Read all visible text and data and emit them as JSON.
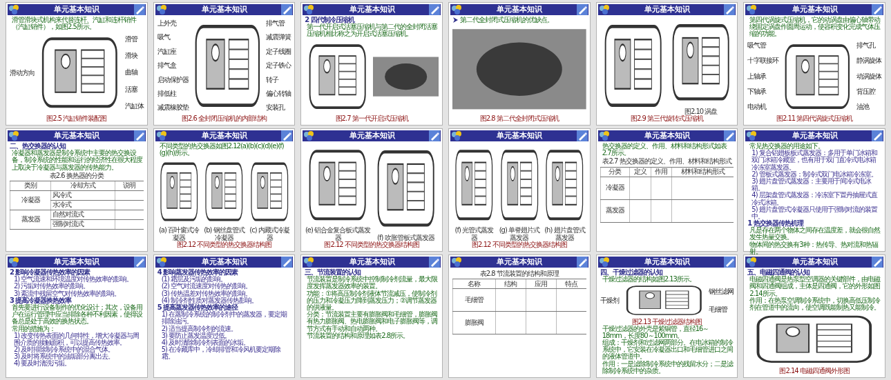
{
  "slides": [
    {
      "title": "单元基本知识",
      "blocks": [
        {
          "kind": "para",
          "text": "滑管滑块式机构来代替连杆、汽缸和连杆销件（汽缸销件），如图2.5所示。"
        },
        {
          "kind": "figures",
          "figures": [
            {
              "kind": "drawing",
              "labels_left": [
                "滑动方向"
              ],
              "labels_right": [
                "滑管",
                "滑块",
                "曲轴",
                "活塞",
                "汽缸体"
              ]
            }
          ]
        },
        {
          "kind": "caption",
          "text": "图2.5 汽缸销件装配图"
        }
      ]
    },
    {
      "title": "单元基本知识",
      "blocks": [
        {
          "kind": "figures",
          "figures": [
            {
              "kind": "drawing",
              "labels_left": [
                "上外壳",
                "吸气",
                "汽缸座",
                "排气盒",
                "启动保护器",
                "排低柱",
                "减震橡胶垫"
              ],
              "labels_right": [
                "排气管",
                "减震弹簧",
                "定子线圈",
                "定子铁心",
                "转子",
                "偏心转轴",
                "安装孔"
              ]
            }
          ]
        },
        {
          "kind": "caption",
          "text": "图2.6 全封闭压缩机的内部结构"
        }
      ]
    },
    {
      "title": "单元基本知识",
      "blocks": [
        {
          "kind": "heading",
          "text": "2 四代制冷压缩机"
        },
        {
          "kind": "para",
          "text": "第一代开启式活塞压缩机与第二代的全封闭活塞压缩机相比称之为开启式活塞压缩机。"
        },
        {
          "kind": "figures",
          "figures": [
            {
              "kind": "drawing"
            },
            {
              "kind": "photo"
            }
          ]
        },
        {
          "kind": "caption",
          "text": "图2.7 第一代开启式压缩机"
        }
      ]
    },
    {
      "title": "单元基本知识",
      "blocks": [
        {
          "kind": "bullet",
          "text": "第二代全封闭式压缩机的优缺点。"
        },
        {
          "kind": "figures",
          "figures": [
            {
              "kind": "photo"
            }
          ]
        },
        {
          "kind": "caption",
          "text": "图2.8 第二代全封闭式压缩机"
        }
      ]
    },
    {
      "title": "单元基本知识",
      "blocks": [
        {
          "kind": "figures",
          "figures": [
            {
              "kind": "drawing"
            },
            {
              "kind": "drawing",
              "caption": "图2.10 涡盘"
            }
          ]
        },
        {
          "kind": "caption",
          "text": "图2.9 第三代旋转式压缩机"
        }
      ]
    },
    {
      "title": "单元基本知识",
      "blocks": [
        {
          "kind": "para",
          "text": "第四代涡旋式压缩机，它的动涡盘由偏心轴带动绕固定涡盘作圆周运动，使容积变化完成气体压缩的功能。"
        },
        {
          "kind": "figures",
          "figures": [
            {
              "kind": "drawing",
              "labels_left": [
                "吸气管",
                "十字联接环",
                "上轴承",
                "下轴承",
                "电动机"
              ],
              "labels_right": [
                "排气孔",
                "静涡旋体",
                "动涡旋体",
                "背压腔",
                "油池"
              ]
            }
          ]
        },
        {
          "kind": "caption",
          "text": "图2.11 第四代涡旋式压缩机"
        }
      ]
    },
    {
      "title": "单元基本知识",
      "blocks": [
        {
          "kind": "heading",
          "text": "二、热交换器的认知"
        },
        {
          "kind": "para",
          "text": "冷凝器和蒸发器是制冷系统中主要的热交换设备，制冷系统的性能和运行的经济性在很大程度上取决于冷凝器与蒸发器的传热能力。"
        },
        {
          "kind": "table",
          "caption": "表2.6 换热器的分类",
          "columns": [
            "类别",
            "冷却方式",
            "说明"
          ],
          "groups": [
            {
              "name": "冷凝器",
              "types": [
                "风冷式",
                "水冷式"
              ]
            },
            {
              "name": "蒸发器",
              "types": [
                "自然对流式",
                "强制对流式"
              ]
            }
          ]
        }
      ]
    },
    {
      "title": "单元基本知识",
      "blocks": [
        {
          "kind": "para",
          "text": "不同类型的热交换器如图2.12(a)(b)(c)(d)(e)(f)(g)(h)所示。"
        },
        {
          "kind": "figures",
          "figures": [
            {
              "kind": "drawing",
              "caption": "(a) 百叶窗式冷凝器"
            },
            {
              "kind": "drawing",
              "caption": "(b) 钢丝盘管式冷凝器"
            },
            {
              "kind": "drawing",
              "caption": "(c) 内藏式冷凝器"
            }
          ]
        },
        {
          "kind": "caption",
          "text": "图2.12 不同类型的热交换器结构图"
        }
      ]
    },
    {
      "title": "单元基本知识",
      "blocks": [
        {
          "kind": "figures",
          "figures": [
            {
              "kind": "drawing",
              "caption": "(e) 铝合金复合板式蒸发器"
            },
            {
              "kind": "drawing",
              "caption": "(f) 吹胀管板式蒸发器"
            }
          ]
        },
        {
          "kind": "caption",
          "text": "图2.12 不同类型的热交换器结构图"
        }
      ]
    },
    {
      "title": "单元基本知识",
      "blocks": [
        {
          "kind": "figures",
          "figures": [
            {
              "kind": "drawing",
              "caption": "(f) 光管式蒸发器"
            },
            {
              "kind": "drawing",
              "caption": "(g) 单脊翅片式蒸发器"
            },
            {
              "kind": "drawing",
              "caption": "(h) 翅片盘管式蒸发器"
            }
          ]
        },
        {
          "kind": "caption",
          "text": "图2.12 不同类型的热交换器结构图"
        }
      ]
    },
    {
      "title": "单元基本知识",
      "blocks": [
        {
          "kind": "para",
          "text": "热交换器的定义、作用、材料和结构形式如表2.7所示。"
        },
        {
          "kind": "table",
          "caption": "表2.7 热交换器的定义、作用、材料和结构形式",
          "columns": [
            "分类",
            "定义",
            "作用",
            "材料和结构形式"
          ],
          "groups": [
            {
              "name": "冷凝器"
            },
            {
              "name": "蒸发器"
            }
          ]
        }
      ]
    },
    {
      "title": "单元基本知识",
      "blocks": [
        {
          "kind": "para",
          "text": "常见热交换器的用途如下。"
        },
        {
          "kind": "item",
          "text": "1) 复合铝翅板板式蒸发器：多用于单门冰箱和双门冰箱冷藏室，也有用于双门直冷式电冰箱冷冻室蒸发器。"
        },
        {
          "kind": "item",
          "text": "2) 管板式蒸发器：制冷式双门电冰箱冷冻室。"
        },
        {
          "kind": "item",
          "text": "3) 翅片盘管式蒸发器：主要用于间冷式电冰箱。"
        },
        {
          "kind": "item",
          "text": "4) 层架盘管式蒸发器：冷冻室下置丹抽屉式直冷式冰箱。"
        },
        {
          "kind": "item",
          "text": "5) 翅片盘管式冷凝器只使用于强制对流的装置中。"
        },
        {
          "kind": "heading",
          "text": "1 热交换器传热机理"
        },
        {
          "kind": "para",
          "text": "凡是存在两个物体之间存在温度差，就会很自然发生热量交换。"
        },
        {
          "kind": "para",
          "text": "物体间的热交换有3种：热传导、热对流和热辐射。"
        }
      ]
    },
    {
      "title": "单元基本知识",
      "blocks": [
        {
          "kind": "heading",
          "text": "2 影响冷凝器传热效率的因素"
        },
        {
          "kind": "item",
          "text": "1) 空气流速和环境温度对传热效率的影响。"
        },
        {
          "kind": "item",
          "text": "2) 污垢对传热效率的影响。"
        },
        {
          "kind": "item",
          "text": "3) 紊流中残留空气对传热效率的影响。"
        },
        {
          "kind": "heading",
          "text": "3 提高冷凝器换热效率"
        },
        {
          "kind": "para",
          "text": "首先要进行设备制作的优化设计；其次，设备用户在运行管理中应当排除各种不利因素，使得设备总是处于高效的换热状态。"
        },
        {
          "kind": "para",
          "text": "常用的措施为："
        },
        {
          "kind": "item",
          "text": "1) 改变传热表面的几何特性，增大冷凝器与周围介质的接触面积，可以提高传热效率。"
        },
        {
          "kind": "item",
          "text": "2) 及时排除制冷系统中的混合气体。"
        },
        {
          "kind": "item",
          "text": "3) 及时将系统中的油垢部分离出去。"
        },
        {
          "kind": "item",
          "text": "4) 要及时清洗污垢。"
        }
      ]
    },
    {
      "title": "单元基本知识",
      "blocks": [
        {
          "kind": "heading",
          "text": "4 影响蒸发器传热效率的因素"
        },
        {
          "kind": "item",
          "text": "(1) 霜层及污垢的影响。"
        },
        {
          "kind": "item",
          "text": "(2) 空气对流速度对传热的影响。"
        },
        {
          "kind": "item",
          "text": "(3) 传热温差对传热效率的影响。"
        },
        {
          "kind": "item",
          "text": "(4) 制冷剂性质对蒸发器传热影响。"
        },
        {
          "kind": "heading",
          "text": "5 提高蒸发器传热效率的途径"
        },
        {
          "kind": "item",
          "text": "1) 在蒸制冷系统的制冷剂中的蒸发器，要定期排除油污。"
        },
        {
          "kind": "item",
          "text": "2) 适当提高制冷剂的流速。"
        },
        {
          "kind": "item",
          "text": "3) 要防止蒸发温度过低。"
        },
        {
          "kind": "item",
          "text": "4) 及时清除制冷剂表面的冰垢。"
        },
        {
          "kind": "item",
          "text": "5) 在冷藏库中，冷却排管和冷风机要定期除霜。"
        }
      ]
    },
    {
      "title": "单元基本知识",
      "blocks": [
        {
          "kind": "heading",
          "text": "三、节流装置的认知"
        },
        {
          "kind": "para",
          "text": "节流装置是制冷系统中控制制冷剂流量，最大限度发挥蒸发器效率的装置。"
        },
        {
          "kind": "para",
          "text": "功能：①将高压制冷剂液体节流减压，使制冷剂的压力和冷凝压力降到蒸发压力；②调节蒸发器的供液量。"
        },
        {
          "kind": "para",
          "text": "分类：节流装置主要有膨胀阀和毛细管，膨胀阀有热力膨胀阀、热电膨胀阀和电子膨胀阀等，调节方式有手动和自动两种。"
        },
        {
          "kind": "para",
          "text": "节流装置的结构和原理如表2.8所示。"
        }
      ]
    },
    {
      "title": "单元基本知识",
      "blocks": [
        {
          "kind": "table",
          "caption": "表2.8 节流装置的结构和原理",
          "columns": [
            "名称",
            "结构",
            "应用",
            "特点"
          ],
          "groups": [
            {
              "name": "毛细管"
            },
            {
              "name": "膨胀阀"
            }
          ]
        }
      ]
    },
    {
      "title": "单元基本知识",
      "blocks": [
        {
          "kind": "heading",
          "text": "四、干燥过滤器的认知"
        },
        {
          "kind": "para",
          "text": "干燥过滤器的结构如图2.13所示。"
        },
        {
          "kind": "figures",
          "figures": [
            {
              "kind": "drawing",
              "labels_left": [
                "干燥剂"
              ],
              "labels_right": [
                "钢丝滤网",
                "毛细管"
              ]
            }
          ]
        },
        {
          "kind": "caption",
          "text": "图2.13 干燥过滤器结构图"
        },
        {
          "kind": "para",
          "text": "干燥过滤器的外壳是紫铜管，直径16～18mm，长度80～100mm。"
        },
        {
          "kind": "para",
          "text": "组成：干燥剂和过滤网两部分。在电冰箱的制冷系统中，它安装在冷凝器出口和毛细管进口之间的液体管道中。"
        },
        {
          "kind": "para",
          "text": "作用：一是滤除制冷系统中的残留水分；二是滤除制冷系统中的杂质。"
        }
      ]
    },
    {
      "title": "单元基本知识",
      "blocks": [
        {
          "kind": "heading",
          "text": "五、电磁四通阀的认知"
        },
        {
          "kind": "para",
          "text": "电磁四通阀是热泵型空调器的关键部件，由电磁阀和四通阀组成，主体是四通阀，它的外形如图2.14所示。"
        },
        {
          "kind": "para",
          "text": "作用：在热泵空调制冷系统中，切换高低压制冷剂在管道中的流向，使空调既能制热又能制冷。"
        },
        {
          "kind": "figures",
          "figures": [
            {
              "kind": "drawing"
            }
          ]
        },
        {
          "kind": "caption",
          "text": "图2.14 电磁四通阀外形图"
        }
      ]
    }
  ]
}
